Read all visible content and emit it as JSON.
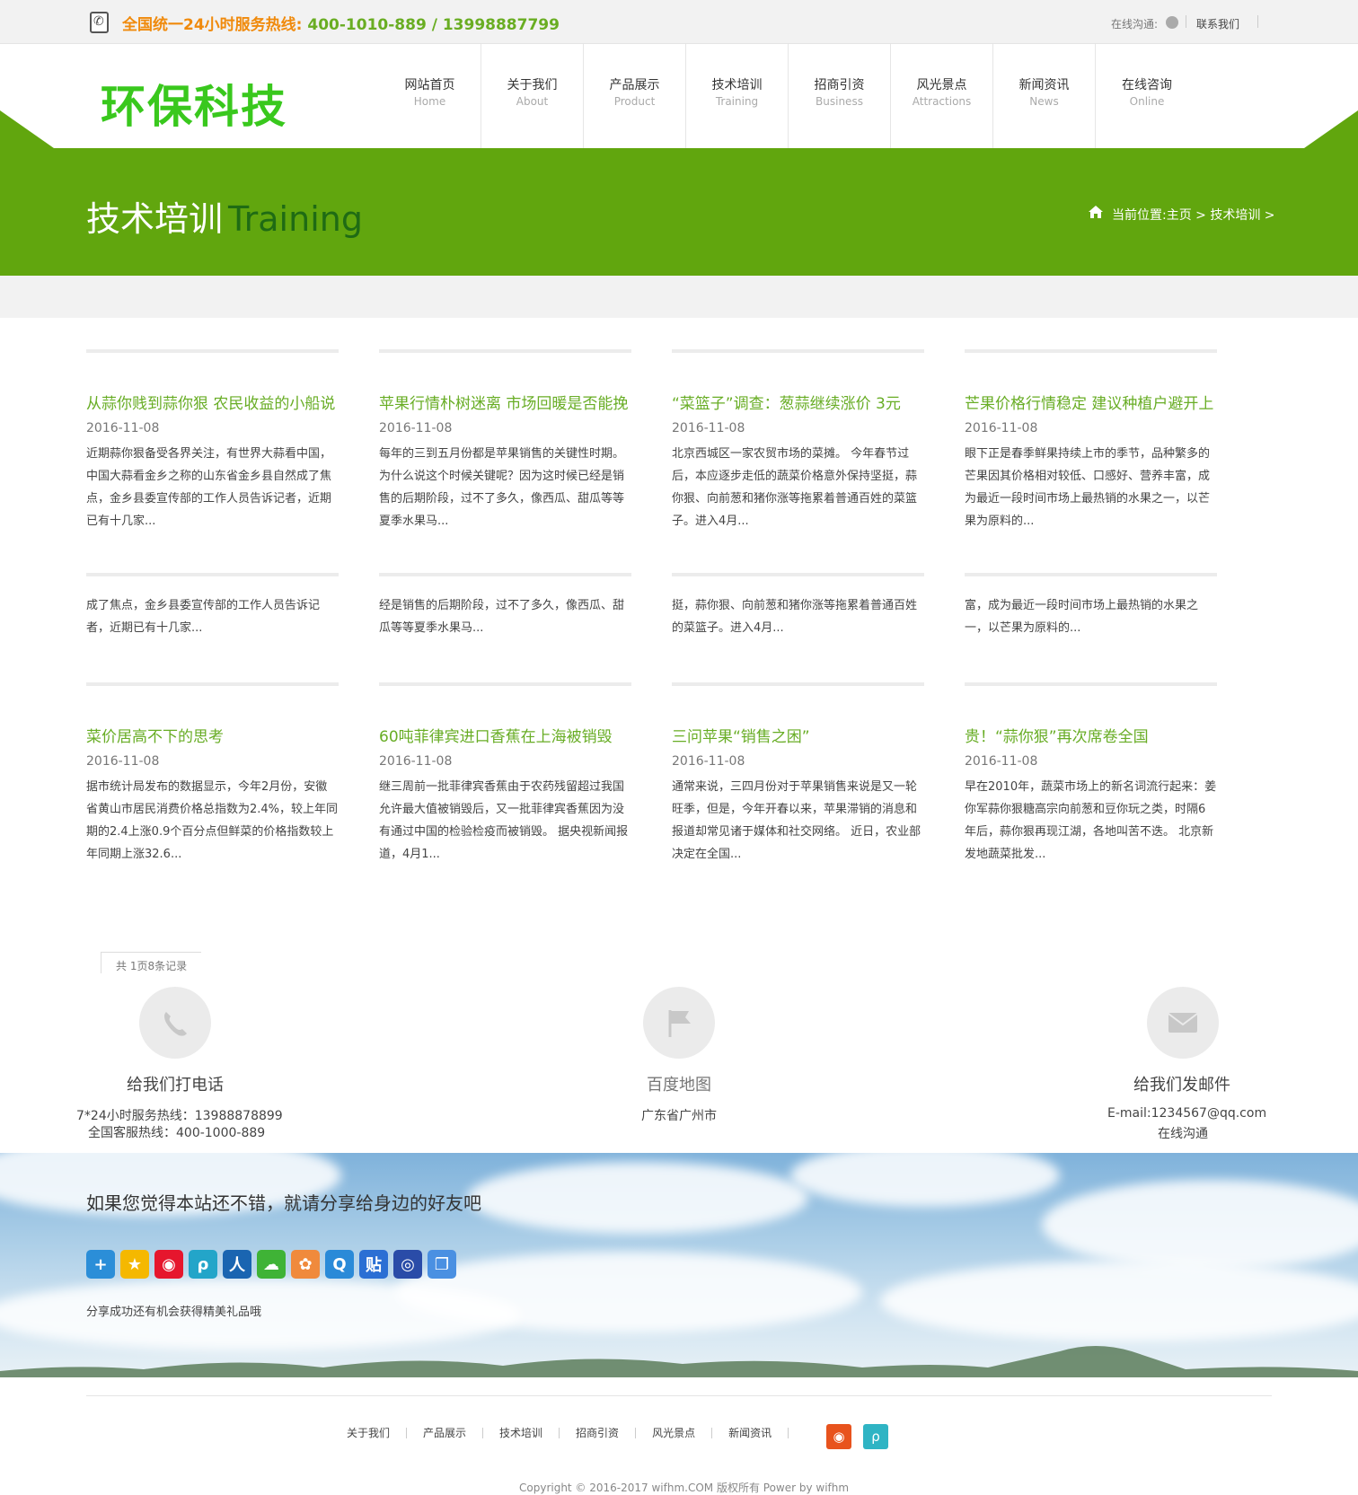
{
  "topbar": {
    "hotline_label": "全国统一24小时服务热线:",
    "hotline_numbers": "400-1010-889  / 13998887799",
    "online_label": "在线沟通:",
    "contact_link": "联系我们"
  },
  "logo": "环保科技",
  "nav": [
    {
      "cn": "网站首页",
      "en": "Home"
    },
    {
      "cn": "关于我们",
      "en": "About"
    },
    {
      "cn": "产品展示",
      "en": "Product"
    },
    {
      "cn": "技术培训",
      "en": "Training"
    },
    {
      "cn": "招商引资",
      "en": "Business"
    },
    {
      "cn": "风光景点",
      "en": "Attractions"
    },
    {
      "cn": "新闻资讯",
      "en": "News"
    },
    {
      "cn": "在线咨询",
      "en": "Online"
    }
  ],
  "banner": {
    "title_cn": "技术培训",
    "title_en": "Training",
    "breadcrumb": "当前位置:主页 > 技术培训 >"
  },
  "articles_row1": [
    {
      "title": "从蒜你贱到蒜你狠   农民收益的小船说",
      "date": "2016-11-08",
      "desc": "近期蒜你狠备受各界关注，有世界大蒜看中国，中国大蒜看金乡之称的山东省金乡县自然成了焦点，金乡县委宣传部的工作人员告诉记者，近期已有十几家..."
    },
    {
      "title": "苹果行情朴树迷离   市场回暖是否能挽",
      "date": "2016-11-08",
      "desc": "每年的三到五月份都是苹果销售的关键性时期。为什么说这个时候关键呢？因为这时候已经是销售的后期阶段，过不了多久，像西瓜、甜瓜等等夏季水果马..."
    },
    {
      "title": "“菜篮子”调查：葱蒜继续涨价   3元",
      "date": "2016-11-08",
      "desc": "北京西城区一家农贸市场的菜摊。 今年春节过后，本应逐步走低的蔬菜价格意外保持坚挺，蒜你狠、向前葱和猪你涨等拖累着普通百姓的菜篮子。进入4月..."
    },
    {
      "title": "芒果价格行情稳定   建议种植户避开上",
      "date": "2016-11-08",
      "desc": "眼下正是春季鲜果持续上市的季节，品种繁多的芒果因其价格相对较低、口感好、营养丰富，成为最近一段时间市场上最热销的水果之一，以芒果为原料的..."
    }
  ],
  "articles_row2": [
    {
      "desc": "成了焦点，金乡县委宣传部的工作人员告诉记者，近期已有十几家..."
    },
    {
      "desc": "经是销售的后期阶段，过不了多久，像西瓜、甜瓜等等夏季水果马..."
    },
    {
      "desc": "挺，蒜你狠、向前葱和猪你涨等拖累着普通百姓的菜篮子。进入4月..."
    },
    {
      "desc": "富，成为最近一段时间市场上最热销的水果之一，以芒果为原料的..."
    }
  ],
  "articles_row3": [
    {
      "title": "菜价居高不下的思考",
      "date": "2016-11-08",
      "desc": "据市统计局发布的数据显示，今年2月份，安徽省黄山市居民消费价格总指数为2.4%，较上年同期的2.4上涨0.9个百分点但鲜菜的价格指数较上年同期上涨32.6..."
    },
    {
      "title": "60吨菲律宾进口香蕉在上海被销毁",
      "date": "2016-11-08",
      "desc": "继三周前一批菲律宾香蕉由于农药残留超过我国允许最大值被销毁后，又一批菲律宾香蕉因为没有通过中国的检验检疫而被销毁。 据央视新闻报道，4月1..."
    },
    {
      "title": "三问苹果“销售之困”",
      "date": "2016-11-08",
      "desc": "通常来说，三四月份对于苹果销售来说是又一轮旺季，但是，今年开春以来，苹果滞销的消息和报道却常见诸于媒体和社交网络。 近日，农业部决定在全国..."
    },
    {
      "title": "贵！“蒜你狠”再次席卷全国",
      "date": "2016-11-08",
      "desc": "早在2010年，蔬菜市场上的新名词流行起来：姜你军蒜你狠糖高宗向前葱和豆你玩之类，时隔6年后，蒜你狠再现江湖，各地叫苦不迭。 北京新发地蔬菜批发..."
    }
  ],
  "pager": "共 1页8条记录",
  "contact": {
    "phone_title": "给我们打电话",
    "phone_line1": "7*24小时服务热线：13988878899",
    "phone_line2": "全国客服热线：400-1000-889",
    "map_title": "百度地图",
    "map_line": "广东省广州市",
    "mail_title": "给我们发邮件",
    "mail_line1": "E-mail:1234567@qq.com",
    "mail_line2": "在线沟通"
  },
  "share": {
    "title": "如果您觉得本站还不错，就请分享给身边的好友吧",
    "note": "分享成功还有机会获得精美礼品哦",
    "icons": [
      "more-icon",
      "qzone-icon",
      "weibo-icon",
      "tqq-icon",
      "renren-icon",
      "wechat-icon",
      "kaixin-icon",
      "qq-icon",
      "tieba-icon",
      "douban-icon",
      "copy-icon"
    ]
  },
  "footer": {
    "links": [
      "关于我们",
      "产品展示",
      "技术培训",
      "招商引资",
      "风光景点",
      "新闻资讯"
    ],
    "copyright": "Copyright © 2016-2017 wifhm.COM 版权所有 Power by wifhm"
  },
  "colors": {
    "brand_green": "#61a60e",
    "title_green": "#68ad25",
    "hotline_orange": "#f08a0c",
    "logo_green": "#39c81d"
  }
}
